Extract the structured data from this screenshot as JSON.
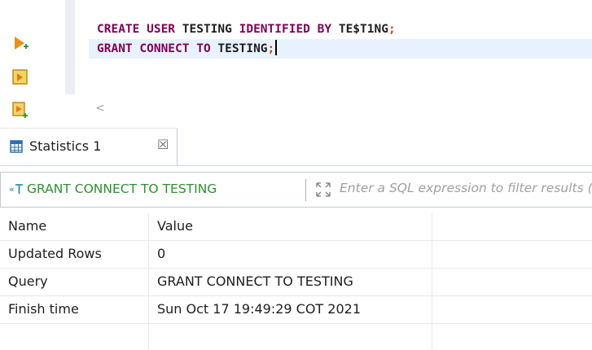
{
  "editor": {
    "lines": [
      {
        "tokens": [
          {
            "text": "CREATE USER",
            "cls": "kw"
          },
          {
            "text": " TESTING ",
            "cls": "ident"
          },
          {
            "text": "IDENTIFIED BY",
            "cls": "kw"
          },
          {
            "text": " TE$T1NG",
            "cls": "ident"
          },
          {
            "text": ";",
            "cls": "punct"
          }
        ]
      },
      {
        "tokens": [
          {
            "text": "GRANT CONNECT TO",
            "cls": "kw"
          },
          {
            "text": " TESTING",
            "cls": "ident"
          },
          {
            "text": ";",
            "cls": "punct"
          }
        ]
      }
    ],
    "scroll_left_glyph": "<"
  },
  "results_tab": {
    "label": "Statistics 1",
    "close_glyph": "☒"
  },
  "filter": {
    "query_label": "GRANT CONNECT TO TESTING",
    "placeholder": "Enter a SQL expression to filter results (use Ctrl+Space)"
  },
  "grid": {
    "columns": [
      "Name",
      "Value"
    ],
    "rows": [
      {
        "name": "Updated Rows",
        "value": "0"
      },
      {
        "name": "Query",
        "value": "GRANT CONNECT TO TESTING"
      },
      {
        "name": "Finish time",
        "value": "Sun Oct 17 19:49:29 COT 2021"
      }
    ]
  },
  "icons": {
    "run": "execute-statement-icon",
    "script": "execute-script-icon",
    "explain": "explain-plan-icon",
    "tab": "grid-table-icon",
    "query": "query-text-icon",
    "expand": "expand-filter-icon"
  },
  "colors": {
    "keyword": "#7f0055",
    "statement_text": "#2d9131",
    "current_line": "#e8f2fe",
    "run_icon": "#e8901a"
  }
}
